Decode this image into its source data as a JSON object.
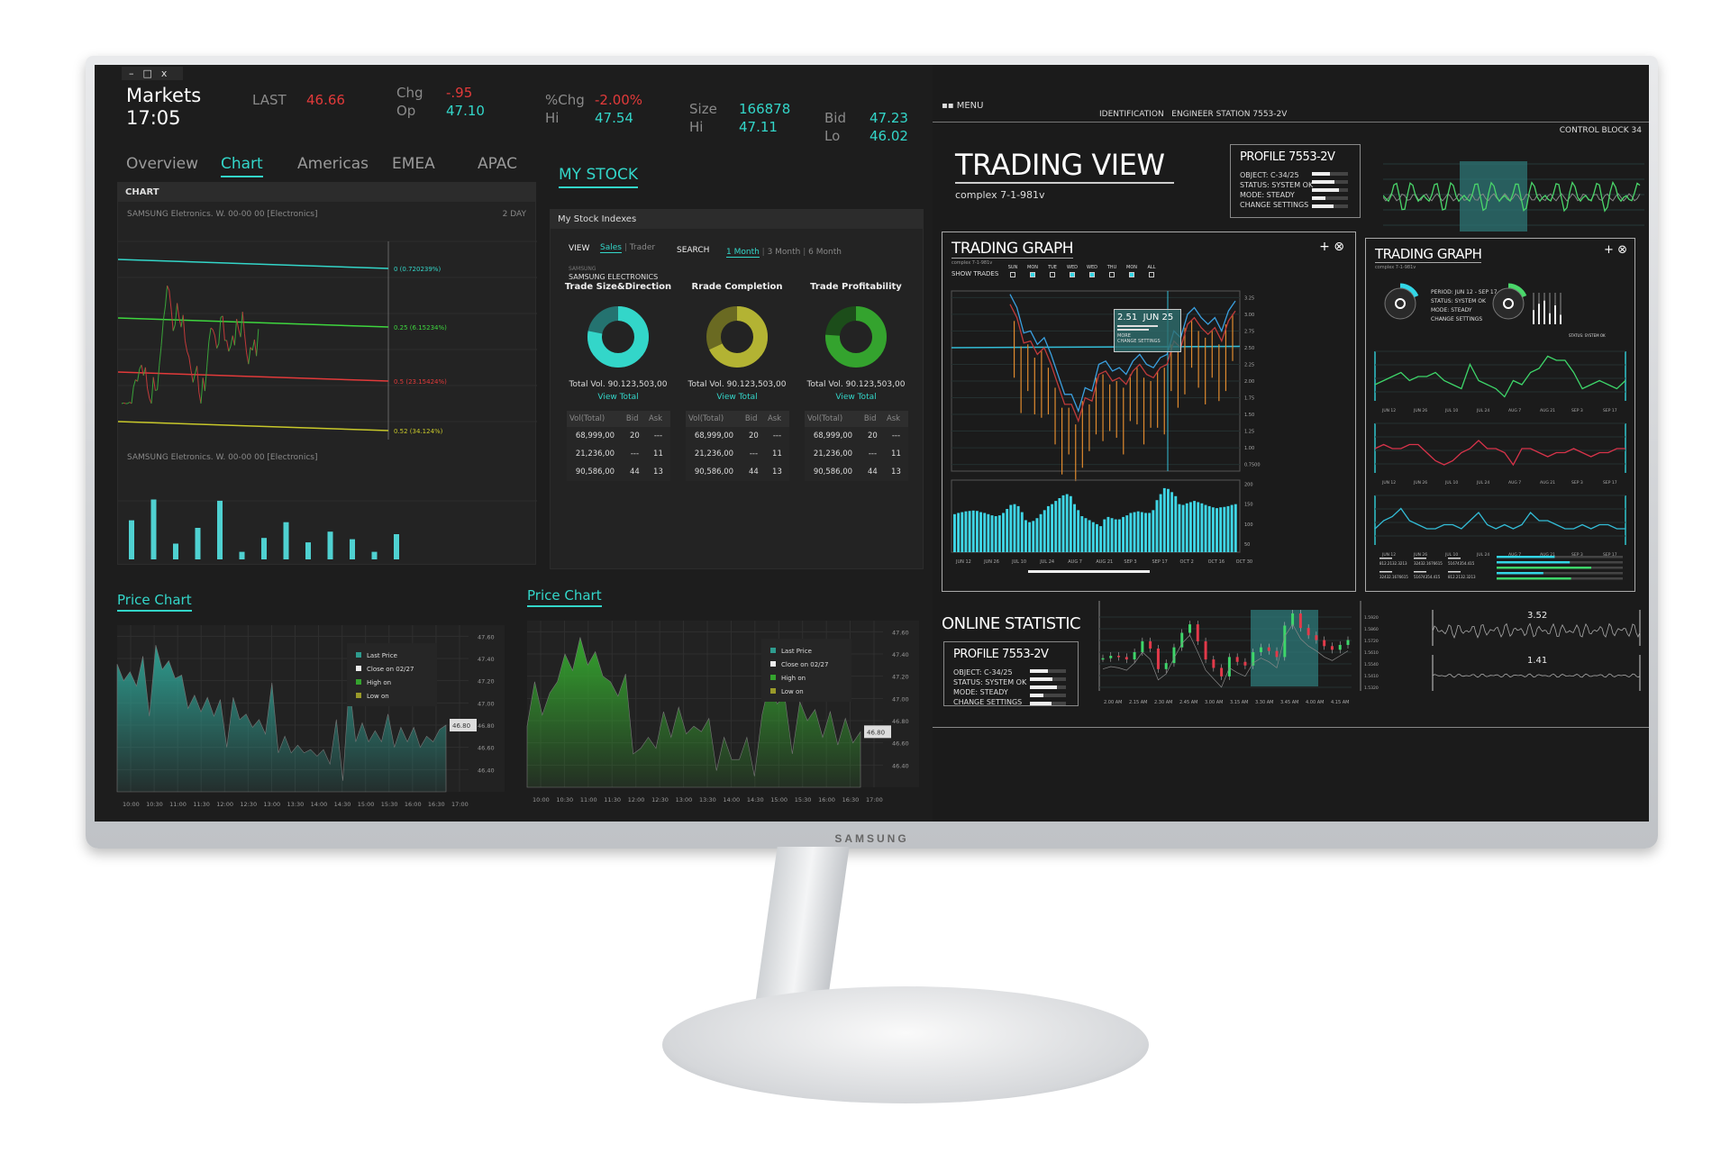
{
  "window": {
    "controls": [
      "–",
      "□",
      "x"
    ]
  },
  "header": {
    "title": "Markets",
    "time": "17:05",
    "quotes": [
      {
        "label": "LAST",
        "value": "46.66",
        "color": "red"
      },
      {
        "label": "Chg",
        "value": "-.95",
        "color": "red"
      },
      {
        "label": "Op",
        "value": "47.10",
        "color": "teal"
      },
      {
        "label": "%Chg",
        "value": "-2.00%",
        "color": "red"
      },
      {
        "label": "Hi",
        "value": "47.54",
        "color": "teal"
      },
      {
        "label": "Size",
        "value": "166878",
        "color": "teal"
      },
      {
        "label": "Hi",
        "value": "47.11",
        "color": "teal"
      },
      {
        "label": "Bid",
        "value": "47.23",
        "color": "teal"
      },
      {
        "label": "Lo",
        "value": "46.02",
        "color": "teal"
      }
    ]
  },
  "tabs": [
    {
      "label": "Overview"
    },
    {
      "label": "Chart",
      "active": true
    },
    {
      "label": "Americas"
    },
    {
      "label": "EMEA"
    },
    {
      "label": "APAC"
    },
    {
      "label": "MY STOCK",
      "active": true
    }
  ],
  "chart_panel": {
    "header": "CHART",
    "subtitle": "SAMSUNG Eletronics. W. 00-00 00 [Electronics]",
    "range": "2 DAY",
    "subtitle2": "SAMSUNG Eletronics. W. 00-00 00 [Electronics]",
    "levels": [
      {
        "label": "0 (0.720239%)",
        "color": "#33d6c9"
      },
      {
        "label": "0.25 (6.15234%)",
        "color": "#3ed63e"
      },
      {
        "label": "0.5 (23.15424%)",
        "color": "#e23a3a"
      },
      {
        "label": "0.52 (34.124%)",
        "color": "#c8c82a"
      }
    ],
    "volume": [
      62,
      95,
      25,
      50,
      93,
      12,
      34,
      59,
      27,
      44,
      32,
      12,
      40
    ]
  },
  "my_stock": {
    "header": "My Stock Indexes",
    "view": "VIEW",
    "sales": "Sales",
    "trader": "Trader",
    "search": "SEARCH",
    "periods": [
      "1 Month",
      "3 Month",
      "6 Month"
    ],
    "company_small": "SAMSUNG",
    "company": "SAMSUNG ELECTRONICS",
    "donuts": [
      {
        "title": "Trade Size&Direction",
        "share": 0.78,
        "main": "#33d6c9",
        "dark": "#247370",
        "total": "Total Vol. 90.123,503,00",
        "link": "View Total"
      },
      {
        "title": "Rrade Completion",
        "share": 0.68,
        "main": "#b3b333",
        "dark": "#6a6a22",
        "total": "Total Vol. 90.123,503,00",
        "link": "View Total"
      },
      {
        "title": "Trade Profitability",
        "share": 0.76,
        "main": "#34a32e",
        "dark": "#1c4d1a",
        "total": "Total Vol. 90.123,503,00",
        "link": "View Total"
      }
    ],
    "table": {
      "headers": [
        "Vol(Total)",
        "Bid",
        "Ask"
      ],
      "rows": [
        [
          "68,999,00",
          "20",
          "---"
        ],
        [
          "21,236,00",
          "---",
          "11"
        ],
        [
          "90,586,00",
          "44",
          "13"
        ]
      ]
    }
  },
  "price_charts": [
    {
      "title": "Price Chart",
      "color": "#2e9c8f",
      "tag": "46.80",
      "legend": [
        {
          "label": "Last Price",
          "color": "#2e9c8f"
        },
        {
          "label": "Close on 02/27",
          "color": "#eeeeee"
        },
        {
          "label": "High on",
          "color": "#34a32e"
        },
        {
          "label": "Low on",
          "color": "#9a9a2a"
        }
      ],
      "yticks": [
        "47.60",
        "47.40",
        "47.20",
        "47.00",
        "46.80",
        "46.60",
        "46.40"
      ],
      "xticks": [
        "10:00",
        "10:30",
        "11:00",
        "11:30",
        "12:00",
        "12:30",
        "13:00",
        "13:30",
        "14:00",
        "14:30",
        "15:00",
        "15:30",
        "16:00",
        "16:30",
        "17:00"
      ],
      "values": [
        47.35,
        47.2,
        47.28,
        47.15,
        47.42,
        46.88,
        47.52,
        47.3,
        47.38,
        47.22,
        47.25,
        46.95,
        47.07,
        46.92,
        47.05,
        46.88,
        47.03,
        46.6,
        47.05,
        46.85,
        46.9,
        46.78,
        46.85,
        46.72,
        47.18,
        46.55,
        46.7,
        46.55,
        46.62,
        46.55,
        46.58,
        46.52,
        46.58,
        46.45,
        46.85,
        46.3,
        47.18,
        46.65,
        46.82,
        46.65,
        46.75,
        46.65,
        46.9,
        46.6,
        46.78,
        46.65,
        46.78,
        46.6,
        46.7,
        46.65,
        46.76,
        46.8
      ]
    },
    {
      "title": "Price Chart",
      "color": "#34a32e",
      "tag": "46.80",
      "legend": [
        {
          "label": "Last Price",
          "color": "#2e9c8f"
        },
        {
          "label": "Close on 02/27",
          "color": "#eeeeee"
        },
        {
          "label": "High on",
          "color": "#34a32e"
        },
        {
          "label": "Low on",
          "color": "#9a9a2a"
        }
      ],
      "yticks": [
        "47.60",
        "47.40",
        "47.20",
        "47.00",
        "46.80",
        "46.60",
        "46.40"
      ],
      "xticks": [
        "10:00",
        "10:30",
        "11:00",
        "11:30",
        "12:00",
        "12:30",
        "13:00",
        "13:30",
        "14:00",
        "14:30",
        "15:00",
        "15:30",
        "16:00",
        "16:30",
        "17:00"
      ],
      "values": [
        46.75,
        47.15,
        46.85,
        47.05,
        47.15,
        47.4,
        47.25,
        47.55,
        47.3,
        47.42,
        47.2,
        47.15,
        47.02,
        47.22,
        46.5,
        46.55,
        46.65,
        46.55,
        46.88,
        46.65,
        46.92,
        46.68,
        46.75,
        46.7,
        46.82,
        46.35,
        46.65,
        46.45,
        46.45,
        46.65,
        46.3,
        46.85,
        47.15,
        46.95,
        47.02,
        46.5,
        46.97,
        46.8,
        46.9,
        46.65,
        46.88,
        46.58,
        46.82,
        46.6,
        46.7
      ]
    }
  ],
  "right": {
    "menu": "MENU",
    "identification": "IDENTIFICATION",
    "station": "ENGINEER STATION 7553-2V",
    "control_block": "CONTROL BLOCK 34",
    "title": "TRADING VIEW",
    "subtitle": "complex 7-1-981v",
    "profile": {
      "title": "PROFILE 7553-2V",
      "lines": [
        "OBJECT: C-34/25",
        "STATUS: SYSTEM OK",
        "MODE: STEADY",
        "CHANGE SETTINGS"
      ],
      "bars": [
        0.5,
        0.62,
        0.75,
        0.38,
        0.6
      ]
    },
    "trading_graph": {
      "title": "TRADING GRAPH",
      "subtitle": "complex 7-1-981v",
      "show_trades": "SHOW TRADES",
      "days": [
        {
          "d": "SUN",
          "on": false
        },
        {
          "d": "MON",
          "on": true
        },
        {
          "d": "TUE",
          "on": false
        },
        {
          "d": "WED",
          "on": true
        },
        {
          "d": "WED",
          "on": true
        },
        {
          "d": "THU",
          "on": false
        },
        {
          "d": "MON",
          "on": true
        },
        {
          "d": "ALL",
          "on": false
        }
      ],
      "tooltip": {
        "value": "2.51",
        "date": "JUN 25",
        "more": "MORE",
        "settings": "CHANGE SETTINGS"
      },
      "yticks": [
        "3.25",
        "3.00",
        "2.75",
        "2.50",
        "2.25",
        "2.00",
        "1.75",
        "1.50",
        "1.25",
        "1.00",
        "0.7500"
      ],
      "vticks": [
        "200",
        "150",
        "100",
        "50"
      ],
      "xticks": [
        "JUN 12",
        "JUN 26",
        "JUL 10",
        "JUL 24",
        "AUG 7",
        "AUG 21",
        "SEP 3",
        "SEP 17",
        "OCT 2",
        "OCT 16",
        "OCT 30"
      ],
      "line": [
        3.3,
        3.1,
        2.72,
        2.75,
        2.55,
        2.65,
        2.4,
        2.1,
        1.8,
        1.8,
        1.55,
        1.9,
        1.85,
        2.25,
        2.3,
        2.15,
        2.2,
        2.1,
        2.3,
        2.4,
        2.25,
        2.2,
        2.35,
        2.4,
        2.75,
        2.65,
        3.0,
        3.1,
        2.95,
        2.85,
        2.95,
        2.75,
        3.05,
        3.2
      ],
      "volume": [
        125,
        128,
        130,
        132,
        133,
        134,
        133,
        130,
        128,
        125,
        122,
        120,
        122,
        128,
        138,
        148,
        150,
        145,
        130,
        110,
        105,
        108,
        115,
        125,
        135,
        145,
        150,
        158,
        165,
        172,
        175,
        170,
        150,
        135,
        120,
        115,
        110,
        105,
        100,
        95,
        112,
        118,
        115,
        112,
        112,
        118,
        122,
        128,
        130,
        132,
        130,
        128,
        128,
        135,
        160,
        175,
        190,
        188,
        180,
        170,
        150,
        148,
        152,
        155,
        158,
        155,
        152,
        148,
        145,
        142,
        140,
        142,
        143,
        145,
        148,
        150
      ]
    },
    "trading_graph2": {
      "title": "TRADING GRAPH",
      "subtitle": "complex 7-1-981v",
      "info": [
        "PERIOD: JUN 12 - SEP 17",
        "STATUS: SYSTEM OK",
        "MODE: STEADY",
        "CHANGE SETTINGS"
      ],
      "status": "STATUS: SYSTEM OK",
      "xticks": [
        "JUN 12",
        "JUN 26",
        "JUL 10",
        "JUL 24",
        "AUG 7",
        "AUG 21",
        "SEP 3",
        "SEP 17"
      ],
      "series": [
        {
          "color": "#3ed66a",
          "values": [
            4,
            5,
            6,
            7,
            5,
            6,
            6,
            7,
            5,
            4,
            3,
            9,
            5,
            4,
            3,
            1,
            5,
            4,
            7,
            8,
            11,
            10,
            10,
            7,
            3,
            4,
            5,
            4,
            3,
            5
          ]
        },
        {
          "color": "#d8334a",
          "values": [
            6,
            7,
            6,
            6,
            7,
            7,
            5,
            3,
            2,
            3,
            5,
            6,
            8,
            6,
            6,
            5,
            2,
            6,
            6,
            5,
            4,
            5,
            5,
            6,
            5,
            4,
            5,
            5,
            6,
            6
          ]
        },
        {
          "color": "#33bcd6",
          "values": [
            4,
            6,
            7,
            9,
            6,
            5,
            4,
            4,
            5,
            5,
            4,
            6,
            8,
            5,
            4,
            5,
            4,
            5,
            8,
            6,
            6,
            5,
            4,
            4,
            5,
            4,
            5,
            5,
            4,
            4
          ]
        }
      ],
      "footer_numbers": [
        "812.2132.3213",
        "32432.1676615",
        "51674354.415",
        "32432.1676615",
        "51674354.415",
        "812.2132.3213"
      ],
      "progress": [
        {
          "v": 0.46,
          "color": "#33d6e6"
        },
        {
          "v": 0.58,
          "color": "#33d6e6"
        },
        {
          "v": 0.75,
          "color": "#3ed66a"
        },
        {
          "v": 0.37,
          "color": "#33d6e6"
        },
        {
          "v": 0.59,
          "color": "#3ed66a"
        }
      ]
    },
    "online": {
      "title": "ONLINE STATISTIC",
      "profile_title": "PROFILE 7553-2V",
      "xticks": [
        "2.00 AM",
        "2.15 AM",
        "2.30 AM",
        "2.45 AM",
        "3.00 AM",
        "3.15 AM",
        "3.30 AM",
        "3.45 AM",
        "4.00 AM",
        "4.15 AM"
      ],
      "yticks": [
        "1.5920",
        "1.5860",
        "1.5720",
        "1.5610",
        "1.5540",
        "1.5410",
        "1.5320"
      ],
      "closes": [
        1.557,
        1.559,
        1.558,
        1.556,
        1.562,
        1.571,
        1.565,
        1.548,
        1.553,
        1.566,
        1.578,
        1.585,
        1.571,
        1.556,
        1.549,
        1.542,
        1.558,
        1.554,
        1.551,
        1.562,
        1.566,
        1.563,
        1.558,
        1.584,
        1.594,
        1.582,
        1.576,
        1.572,
        1.567,
        1.564,
        1.568,
        1.572
      ],
      "mini": [
        {
          "value": "3.52"
        },
        {
          "value": "1.41"
        }
      ]
    }
  },
  "brand": "SAMSUNG"
}
